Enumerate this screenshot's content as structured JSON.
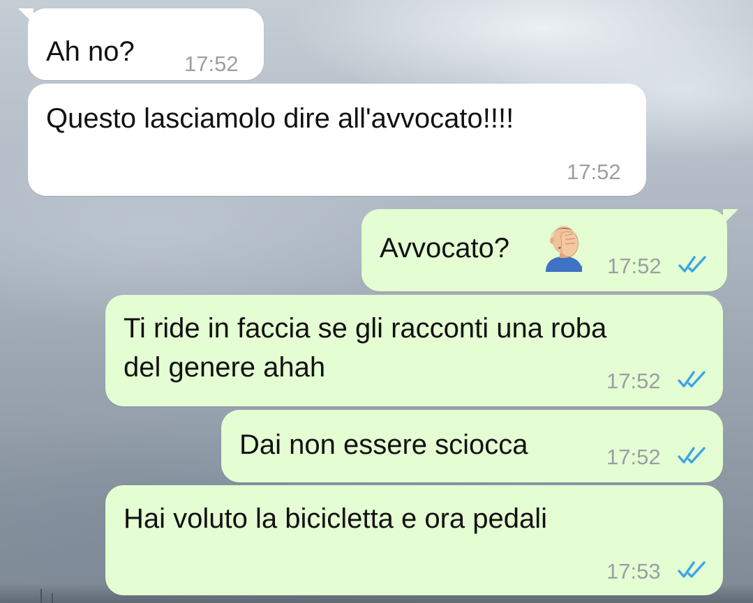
{
  "chat": {
    "messages": [
      {
        "direction": "incoming",
        "text": "Ah no?",
        "time": "17:52"
      },
      {
        "direction": "incoming",
        "text": "Questo lasciamolo dire all'avvocato!!!!",
        "time": "17:52"
      },
      {
        "direction": "outgoing",
        "text": "Avvocato?",
        "emoji": "face-palm-emoji",
        "time": "17:52",
        "status": "read"
      },
      {
        "direction": "outgoing",
        "text_line1": "Ti ride in faccia se gli racconti una roba",
        "text_line2": "del genere ahah",
        "time": "17:52",
        "status": "read"
      },
      {
        "direction": "outgoing",
        "text": "Dai non essere sciocca",
        "time": "17:52",
        "status": "read"
      },
      {
        "direction": "outgoing",
        "text": "Hai voluto la bicicletta e ora pedali",
        "time": "17:53",
        "status": "read"
      }
    ]
  },
  "colors": {
    "incoming_bubble": "#ffffff",
    "outgoing_bubble": "#e4fdd2",
    "read_ticks": "#3aa5e8",
    "timestamp": "#9a9fa3"
  }
}
